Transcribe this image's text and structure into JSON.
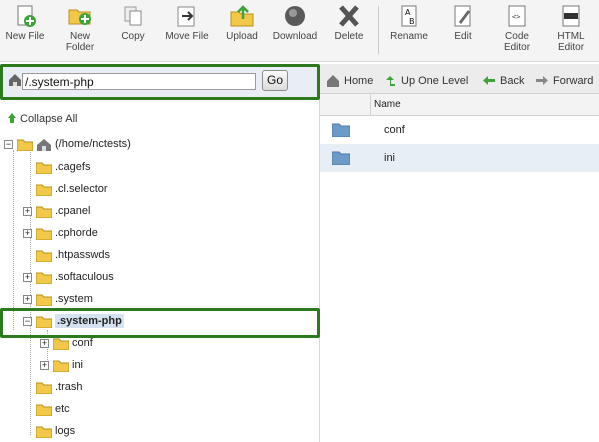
{
  "toolbar": {
    "buttons": [
      {
        "label": "New File",
        "icon": "new-file-icon"
      },
      {
        "label": "New Folder",
        "icon": "new-folder-icon"
      },
      {
        "label": "Copy",
        "icon": "copy-icon"
      },
      {
        "label": "Move File",
        "icon": "move-file-icon"
      },
      {
        "label": "Upload",
        "icon": "upload-icon"
      },
      {
        "label": "Download",
        "icon": "download-icon"
      },
      {
        "label": "Delete",
        "icon": "delete-icon"
      },
      {
        "label": "Rename",
        "icon": "rename-icon"
      },
      {
        "label": "Edit",
        "icon": "edit-icon"
      },
      {
        "label": "Code Editor",
        "icon": "code-editor-icon"
      },
      {
        "label": "HTML Editor",
        "icon": "html-editor-icon"
      }
    ]
  },
  "pathbar": {
    "value": "/.system-php",
    "go_label": "Go"
  },
  "navbar": {
    "home": "Home",
    "up": "Up One Level",
    "back": "Back",
    "forward": "Forward"
  },
  "tree": {
    "collapse_all": "Collapse All",
    "root": "(/home/nctests)",
    "items": [
      {
        "label": ".cagefs",
        "expander": ""
      },
      {
        "label": ".cl.selector",
        "expander": ""
      },
      {
        "label": ".cpanel",
        "expander": "+"
      },
      {
        "label": ".cphorde",
        "expander": "+"
      },
      {
        "label": ".htpasswds",
        "expander": ""
      },
      {
        "label": ".softaculous",
        "expander": "+"
      },
      {
        "label": ".system",
        "expander": "+"
      },
      {
        "label": ".system-php",
        "expander": "−",
        "selected": true
      },
      {
        "label": "conf",
        "expander": "+",
        "child": true
      },
      {
        "label": "ini",
        "expander": "+",
        "child": true
      },
      {
        "label": ".trash",
        "expander": ""
      },
      {
        "label": "etc",
        "expander": ""
      },
      {
        "label": "logs",
        "expander": ""
      }
    ]
  },
  "filelist": {
    "header_name": "Name",
    "rows": [
      {
        "name": "conf"
      },
      {
        "name": "ini"
      }
    ]
  },
  "colors": {
    "highlight_frame": "#2d7a1e",
    "folder": "#f2c84b",
    "selection": "#d6e2ef",
    "row_alt": "#e8eef6"
  }
}
